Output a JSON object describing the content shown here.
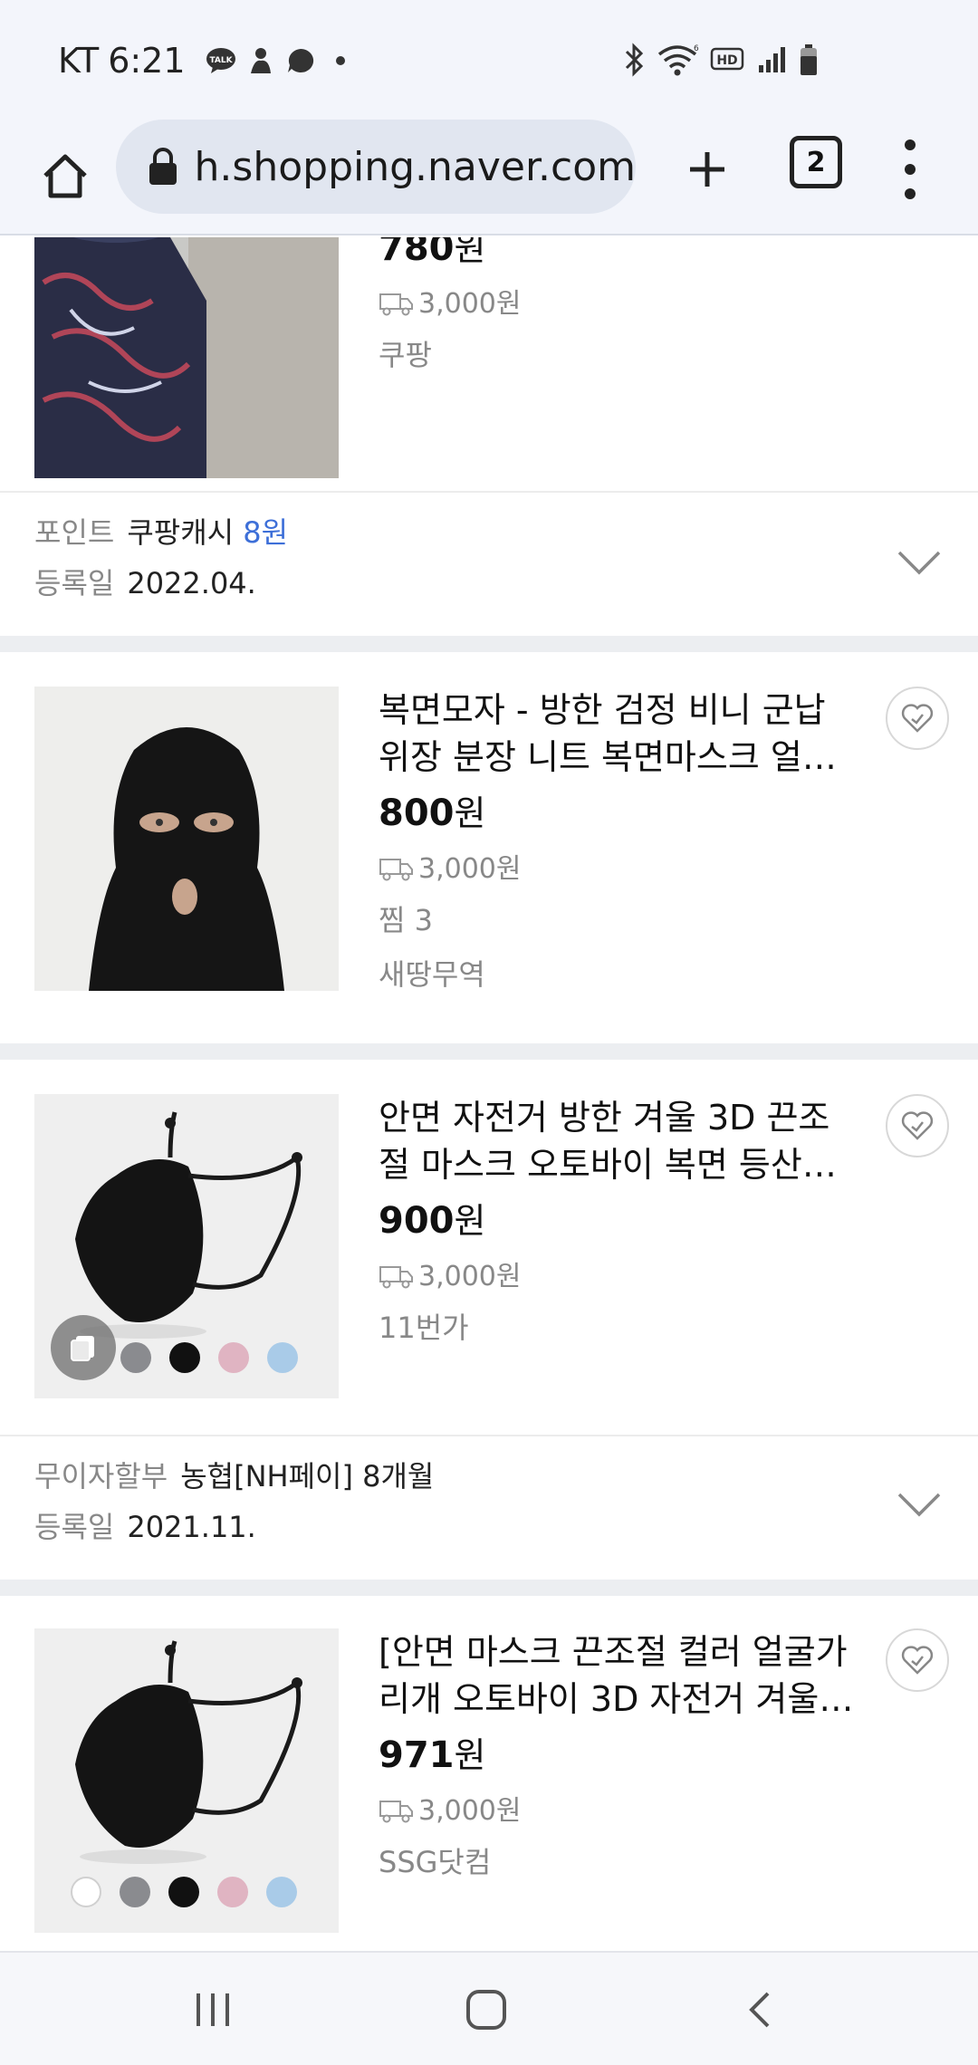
{
  "status_bar": {
    "carrier": "KT",
    "time": "6:21",
    "talk_badge": "TALK"
  },
  "browser": {
    "url": "ch.shopping.naver.com",
    "tab_count": "2"
  },
  "products": [
    {
      "title": "",
      "price_number": "780",
      "price_unit": "원",
      "shipping": "3,000원",
      "meta": [],
      "store": "쿠팡"
    },
    {
      "title": "복면모자 - 방한 검정 비니 군납 위장 분장 니트 복면마스크 얼…",
      "price_number": "800",
      "price_unit": "원",
      "shipping": "3,000원",
      "meta": [
        "찜 3"
      ],
      "store": "새땅무역"
    },
    {
      "title": "안면 자전거 방한 겨울 3D 끈조절 마스크 오토바이 복면 등산 컬…",
      "price_number": "900",
      "price_unit": "원",
      "shipping": "3,000원",
      "meta": [],
      "store": "11번가"
    },
    {
      "title": "[안면 마스크 끈조절 컬러 얼굴가리개 오토바이 3D 자전거 겨울 …",
      "price_number": "971",
      "price_unit": "원",
      "shipping": "3,000원",
      "meta": [],
      "store": "SSG닷컴"
    }
  ],
  "details": [
    {
      "row1_label": "포인트",
      "row1_value": "쿠팡캐시",
      "row1_highlight": "8원",
      "row2_label": "등록일",
      "row2_value": "2022.04."
    },
    {
      "row1_label": "무이자할부",
      "row1_value": "농협[NH페이] 8개월",
      "row1_highlight": "",
      "row2_label": "등록일",
      "row2_value": "2021.11."
    }
  ],
  "colors": {
    "accent_blue": "#3d6fd8",
    "muted_text": "#888888",
    "separator": "#eceef1"
  }
}
